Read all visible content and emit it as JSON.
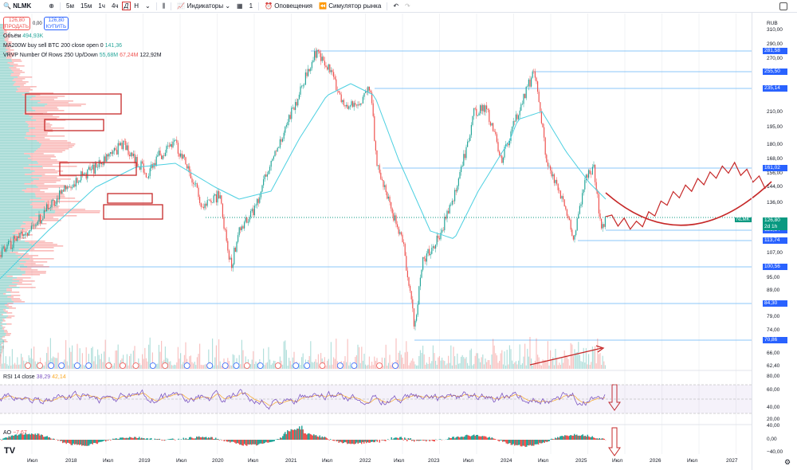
{
  "toolbar": {
    "symbol": "NLMK",
    "timeframes": [
      "5м",
      "15м",
      "1ч",
      "4ч",
      "Д",
      "Н"
    ],
    "indicators": "Индикаторы",
    "alerts": "Оповещения",
    "replay": "Симулятор рынка",
    "layouts_count": "1"
  },
  "trade": {
    "sell_price": "126,80",
    "sell_label": "ПРОДАТЬ",
    "spread": "0,00",
    "buy_price": "126,80",
    "buy_label": "КУПИТЬ"
  },
  "legend": {
    "volume_label": "Объём",
    "volume_value": "494,93K",
    "ma_label": "MA200W buy sell BTC 200 close open 0",
    "ma_value": "141,36",
    "vrvp_label": "VRVP Number Of Rows 250 Up/Down",
    "vrvp_up": "55,68M",
    "vrvp_down": "67,24M",
    "vrvp_total": "122,92M",
    "rsi_label": "RSI 14 close",
    "rsi_value": "38,29",
    "rsi_ma": "42,14",
    "ao_label": "AO",
    "ao_value": "−7,67"
  },
  "axis": {
    "currency": "RUB",
    "prices": [
      "310,00",
      "290,00",
      "270,00",
      "210,00",
      "195,00",
      "180,00",
      "168,00",
      "156,00",
      "144,00",
      "136,00",
      "107,00",
      "95,00",
      "89,00",
      "79,00",
      "74,00",
      "66,00",
      "62,40"
    ],
    "levels": [
      "281,58",
      "255,50",
      "235,14",
      "161,02",
      "125,84",
      "113,74",
      "100,56",
      "84,30",
      "70,86"
    ],
    "current_symbol": "NLMK",
    "current_price": "126,80",
    "countdown": "2d 1h",
    "rsi_ticks": [
      "80,00",
      "60,00",
      "40,00",
      "20,00"
    ],
    "ao_ticks": [
      "40,00",
      "0,00",
      "−40,00"
    ]
  },
  "time_axis": [
    "Июл",
    "2018",
    "Июл",
    "2019",
    "Июл",
    "2020",
    "Июл",
    "2021",
    "Июл",
    "2022",
    "Июл",
    "2023",
    "Июл",
    "2024",
    "Июл",
    "2025",
    "Июл",
    "2026",
    "Июл",
    "2027"
  ],
  "colors": {
    "up": "#26a69a",
    "down": "#ef5350",
    "ma": "#4dd0e1",
    "drawing": "#c62828",
    "level": "#2962ff"
  }
}
